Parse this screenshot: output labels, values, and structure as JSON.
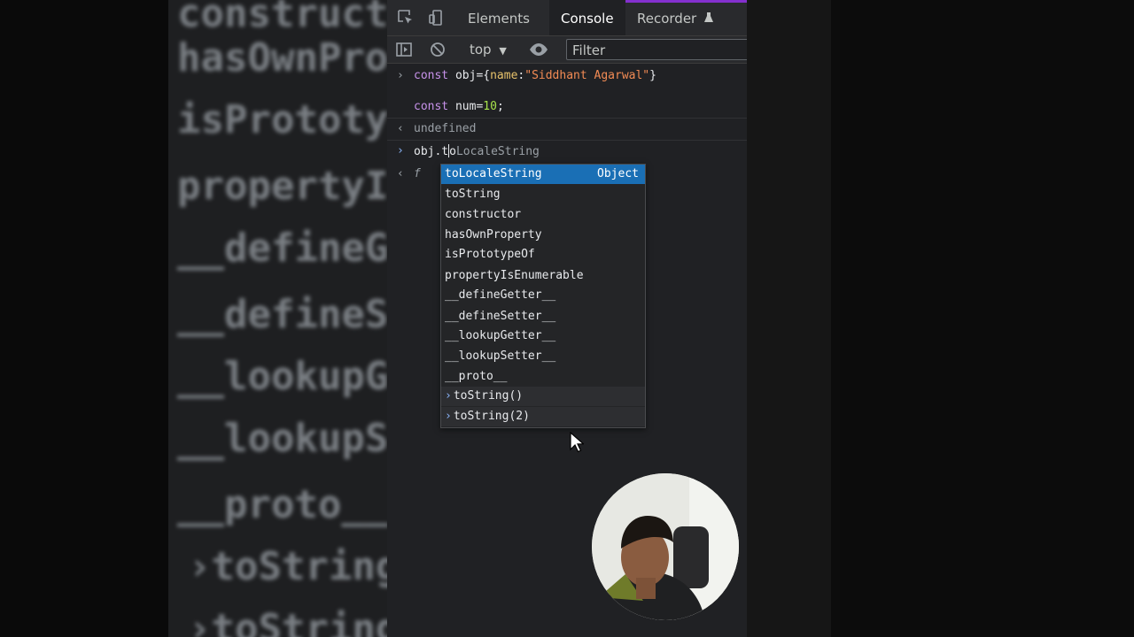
{
  "tabs": {
    "elements": "Elements",
    "console": "Console",
    "recorder": "Recorder"
  },
  "toolbar": {
    "context": "top",
    "filter_placeholder": "Filter"
  },
  "console_lines": {
    "line1_kw": "const",
    "line1_var": "obj",
    "line1_eq": "={",
    "line1_key": "name",
    "line1_colon": ":",
    "line1_str": "\"Siddhant Agarwal\"",
    "line1_end": "}",
    "line2_kw": "const",
    "line2_var": "num",
    "line2_eq": "=",
    "line2_num": "10",
    "line2_end": ";",
    "result": "undefined",
    "input_typed": "obj.t",
    "input_typed2": "o",
    "input_hint": "LocaleString",
    "fn_result": "f"
  },
  "autocomplete": {
    "type_label": "Object",
    "items": [
      "toLocaleString",
      "toString",
      "constructor",
      "hasOwnProperty",
      "isPrototypeOf",
      "propertyIsEnumerable",
      "__defineGetter__",
      "__defineSetter__",
      "__lookupGetter__",
      "__lookupSetter__",
      "__proto__"
    ],
    "history": [
      "toString()",
      "toString(2)"
    ]
  },
  "background_text": [
    "hasOwnPro",
    "isPrototy",
    "propertyI",
    "__defineG",
    "__defineS",
    "__lookupG",
    "__lookupS",
    "__proto__",
    "›toString",
    "›toString"
  ],
  "colors": {
    "selection": "#1a6fb5",
    "keyword": "#c792ea",
    "string": "#f28b54",
    "number": "#a7e34b",
    "recorder_accent": "#8430ce"
  }
}
